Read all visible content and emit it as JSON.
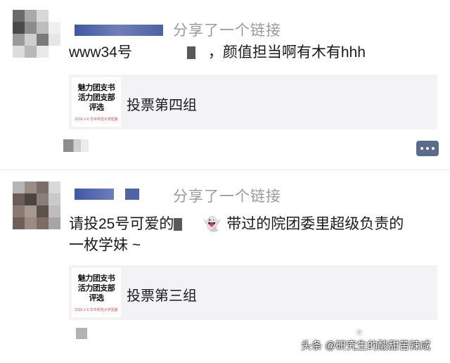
{
  "posts": [
    {
      "share_text": "分享了一个链接",
      "message_start": "www34号",
      "message_end": "，颜值担当啊有木有hhh",
      "link_title": "投票第四组",
      "thumb_lines": [
        "魅力团支书",
        "活力团支部",
        "评选"
      ],
      "thumb_footer": "2016-1-6 华中师范大学团委"
    },
    {
      "share_text": "分享了一个链接",
      "message_line1_start": "请投25号可爱的",
      "message_line1_end": "带过的院团委里超级负责的",
      "message_line2": "一枚学妹 ~",
      "emoji": "👻",
      "link_title": "投票第三组",
      "thumb_lines": [
        "魅力团支书",
        "活力团支部",
        "评选"
      ],
      "thumb_footer": "2016-1-6 华中师范大学团委"
    }
  ],
  "watermark": {
    "text": "头条 @研究生的酸甜苦辣咸"
  },
  "icons": {
    "comment": "comment-dots-icon",
    "ghost": "ghost-emoji-icon"
  },
  "colors": {
    "share_text": "#9a9a9a",
    "name_blur": "#4f63a6",
    "card_bg": "#f3f3f5",
    "comment_button": "#5b6b8c"
  }
}
